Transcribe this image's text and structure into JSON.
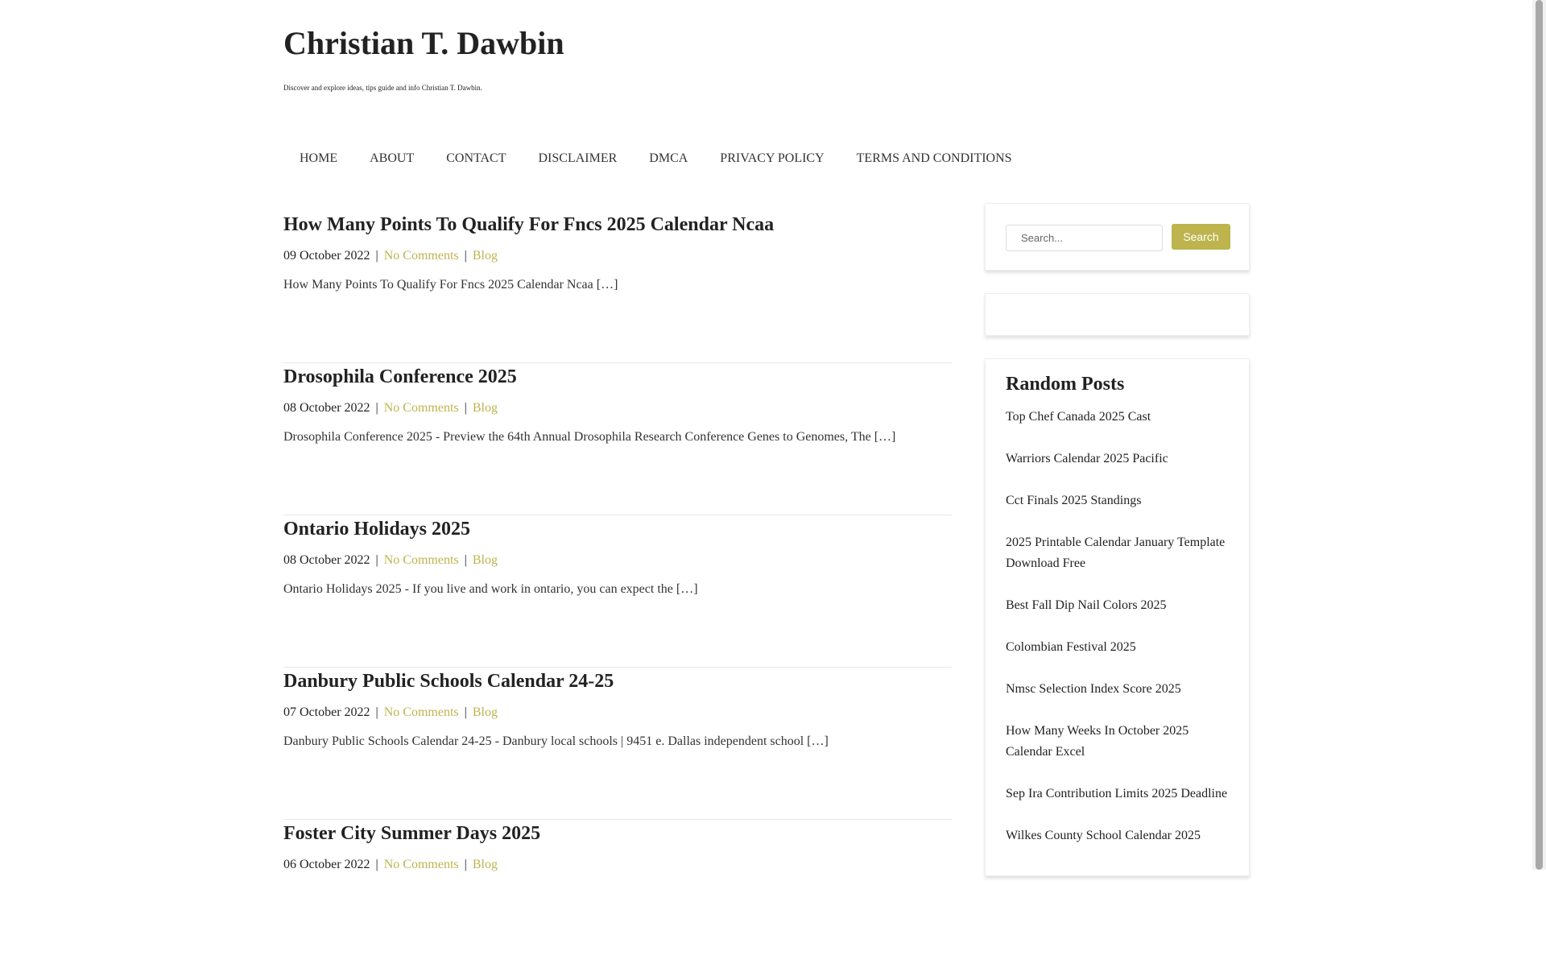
{
  "site": {
    "title": "Christian T. Dawbin",
    "description": "Discover and explore ideas, tips guide and info Christian T. Dawbin."
  },
  "nav": [
    "HOME",
    "ABOUT",
    "CONTACT",
    "DISCLAIMER",
    "DMCA",
    "PRIVACY POLICY",
    "TERMS AND CONDITIONS"
  ],
  "posts": [
    {
      "title": "How Many Points To Qualify For Fncs 2025 Calendar Ncaa",
      "date": "09 October 2022",
      "comments": "No Comments",
      "category": "Blog",
      "excerpt": "How Many Points To Qualify For Fncs 2025 Calendar Ncaa […]"
    },
    {
      "title": "Drosophila Conference 2025",
      "date": "08 October 2022",
      "comments": "No Comments",
      "category": "Blog",
      "excerpt": "Drosophila Conference 2025 - Preview the 64th Annual Drosophila Research Conference Genes to Genomes, The […]"
    },
    {
      "title": "Ontario Holidays 2025",
      "date": "08 October 2022",
      "comments": "No Comments",
      "category": "Blog",
      "excerpt": "Ontario Holidays 2025 - If you live and work in ontario, you can expect the […]"
    },
    {
      "title": "Danbury Public Schools Calendar 24-25",
      "date": "07 October 2022",
      "comments": "No Comments",
      "category": "Blog",
      "excerpt": "Danbury Public Schools Calendar 24-25 - Danbury local schools | 9451 e. Dallas independent school […]"
    },
    {
      "title": "Foster City Summer Days 2025",
      "date": "06 October 2022",
      "comments": "No Comments",
      "category": "Blog",
      "excerpt": ""
    }
  ],
  "meta_separator": "|",
  "search": {
    "placeholder": "Search...",
    "button_label": "Search"
  },
  "random_posts": {
    "title": "Random Posts",
    "items": [
      "Top Chef Canada 2025 Cast",
      "Warriors Calendar 2025 Pacific",
      "Cct Finals 2025 Standings",
      "2025 Printable Calendar January Template Download Free",
      "Best Fall Dip Nail Colors 2025",
      "Colombian Festival 2025",
      "Nmsc Selection Index Score 2025",
      "How Many Weeks In October 2025 Calendar Excel",
      "Sep Ira Contribution Limits 2025 Deadline",
      "Wilkes County School Calendar 2025"
    ]
  },
  "colors": {
    "accent": "#bdb44e"
  }
}
